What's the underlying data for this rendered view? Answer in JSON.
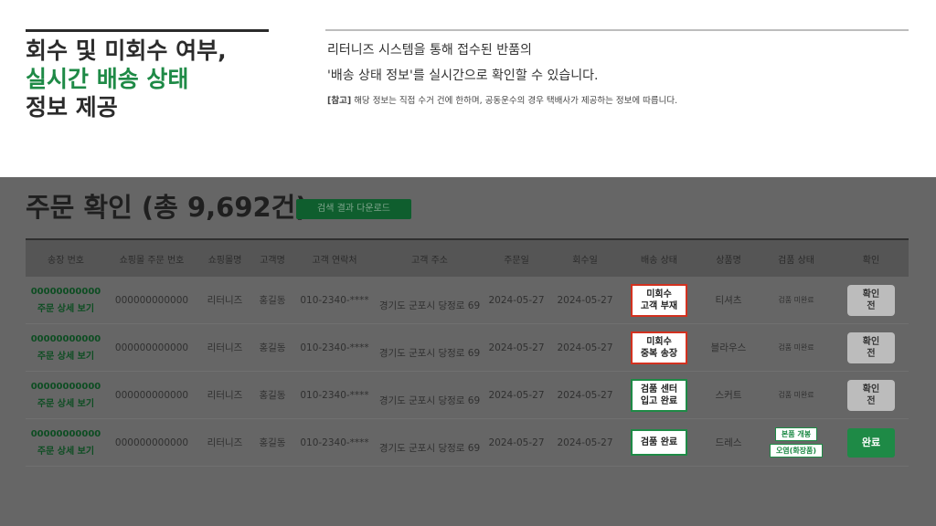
{
  "headline": {
    "line1": "회수 및 미회수 여부,",
    "line2": "실시간 배송 상태",
    "line3": "정보 제공"
  },
  "description": {
    "line1": "리터니즈 시스템을 통해 접수된 반품의",
    "line2": "'배송 상태 정보'를 실시간으로 확인할 수 있습니다.",
    "note_label": "[참고]",
    "note_text": " 해당 정보는 직접 수거 건에 한하며, 공동운수의 경우 택배사가 제공하는 정보에 따릅니다."
  },
  "panel": {
    "title": "주문 확인 (총 9,692건)",
    "download_label": "검색 결과 다운로드",
    "columns": [
      "송장 번호",
      "쇼핑몰 주문 번호",
      "쇼핑몰명",
      "고객명",
      "고객 연락처",
      "고객 주소",
      "주문일",
      "회수일",
      "배송 상태",
      "상품명",
      "검품 상태",
      "확인"
    ],
    "rows": [
      {
        "invoice": "00000000000",
        "detail_link": "주문 상세 보기",
        "order_no": "000000000000",
        "mall": "리터니즈",
        "customer": "홍길동",
        "phone": "010-2340-****",
        "address": "경기도 군포시 당정로 69",
        "order_date": "2024-05-27",
        "return_date": "2024-05-27",
        "status_l1": "미회수",
        "status_l2": "고객 부재",
        "product": "티셔츠",
        "inspection": "검품 미완료",
        "confirm_l1": "확인",
        "confirm_l2": "전"
      },
      {
        "invoice": "00000000000",
        "detail_link": "주문 상세 보기",
        "order_no": "000000000000",
        "mall": "리터니즈",
        "customer": "홍길동",
        "phone": "010-2340-****",
        "address": "경기도 군포시 당정로 69",
        "order_date": "2024-05-27",
        "return_date": "2024-05-27",
        "status_l1": "미회수",
        "status_l2": "중복 송장",
        "product": "블라우스",
        "inspection": "검품 미완료",
        "confirm_l1": "확인",
        "confirm_l2": "전"
      },
      {
        "invoice": "00000000000",
        "detail_link": "주문 상세 보기",
        "order_no": "000000000000",
        "mall": "리터니즈",
        "customer": "홍길동",
        "phone": "010-2340-****",
        "address": "경기도 군포시 당정로 69",
        "order_date": "2024-05-27",
        "return_date": "2024-05-27",
        "status_l1": "검품 센터",
        "status_l2": "입고 완료",
        "product": "스커트",
        "inspection": "검품 미완료",
        "confirm_l1": "확인",
        "confirm_l2": "전"
      },
      {
        "invoice": "00000000000",
        "detail_link": "주문 상세 보기",
        "order_no": "000000000000",
        "mall": "리터니즈",
        "customer": "홍길동",
        "phone": "010-2340-****",
        "address": "경기도 군포시 당정로 69",
        "order_date": "2024-05-27",
        "return_date": "2024-05-27",
        "status_single": "검품 완료",
        "product": "드레스",
        "tag1": "본품 개봉",
        "tag2": "오염(화장품)",
        "confirm_done": "완료"
      }
    ]
  },
  "colors": {
    "accent_green": "#1e8a46",
    "alert_red": "#d2311f",
    "panel_gray": "#666666"
  }
}
